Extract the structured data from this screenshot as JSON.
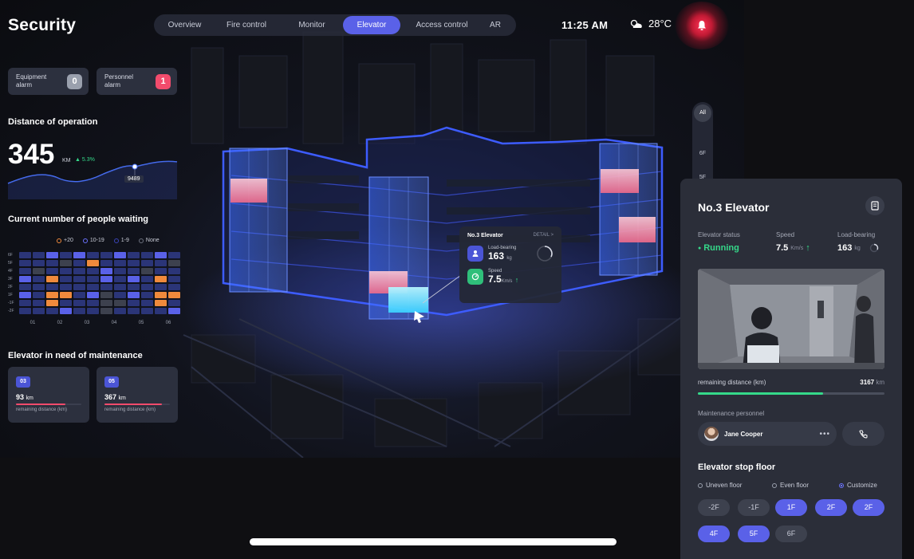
{
  "app_title": "Security",
  "nav": {
    "tabs": [
      {
        "label": "Overview",
        "active": false
      },
      {
        "label": "Fire control",
        "active": false
      },
      {
        "label": "Monitor",
        "active": false
      },
      {
        "label": "Elevator",
        "active": true
      },
      {
        "label": "Access control",
        "active": false
      },
      {
        "label": "AR",
        "active": false
      }
    ]
  },
  "header": {
    "time": "11:25 AM",
    "temperature": "28°C",
    "weather_icon": "cloud-sun-icon"
  },
  "alarms": {
    "equipment": {
      "label": "Equipment alarm",
      "count": "0"
    },
    "personnel": {
      "label": "Personnel alarm",
      "count": "1"
    }
  },
  "distance": {
    "title": "Distance of operation",
    "value": "345",
    "unit": "KM",
    "delta": "5.3%",
    "tooltip": "9489"
  },
  "waiting": {
    "title": "Current number of people waiting",
    "legend": [
      "+20",
      "10-19",
      "1-9",
      "None"
    ],
    "rows": [
      "6F",
      "5F",
      "4F",
      "3F",
      "2F",
      "1F",
      "-1F",
      "-2F"
    ],
    "cols": [
      "01",
      "02",
      "03",
      "04",
      "05",
      "06"
    ]
  },
  "maintenance": {
    "title": "Elevator in need of maintenance",
    "items": [
      {
        "id": "03",
        "value": "93",
        "unit": "km",
        "sub": "remaining distance (km)"
      },
      {
        "id": "05",
        "value": "367",
        "unit": "km",
        "sub": "remaining distance (km)"
      }
    ]
  },
  "floor_filter": [
    "All",
    "6F",
    "5F"
  ],
  "tooltip": {
    "title": "No.3 Elevator",
    "detail": "DETAIL >",
    "load_label": "Load-bearing",
    "load_value": "163",
    "load_unit": "kg",
    "speed_label": "Speed",
    "speed_value": "7.5",
    "speed_unit": "Km/s"
  },
  "panel": {
    "title": "No.3 Elevator",
    "status_label": "Elevator status",
    "status_value": "Running",
    "speed_label": "Speed",
    "speed_value": "7.5",
    "speed_unit": "Km/s",
    "load_label": "Load-bearing",
    "load_value": "163",
    "load_unit": "kg",
    "remaining_label": "remaining distance (km)",
    "remaining_value": "3167",
    "remaining_unit": "km",
    "remaining_fraction": 0.67,
    "personnel_label": "Maintenance personnel",
    "person_name": "Jane Cooper",
    "more": "•••",
    "stop_title": "Elevator stop floor",
    "radio": [
      {
        "label": "Uneven floor",
        "on": false
      },
      {
        "label": "Even floor",
        "on": false
      },
      {
        "label": "Customize",
        "on": true
      }
    ],
    "floors": [
      {
        "label": "-2F",
        "selected": false
      },
      {
        "label": "-1F",
        "selected": false
      },
      {
        "label": "1F",
        "selected": true
      },
      {
        "label": "2F",
        "selected": true
      },
      {
        "label": "2F",
        "selected": true
      },
      {
        "label": "4F",
        "selected": true
      },
      {
        "label": "5F",
        "selected": true
      },
      {
        "label": "6F",
        "selected": false
      }
    ]
  },
  "colors": {
    "accent": "#5a61e8",
    "alarm": "#f24b6c",
    "ok": "#35d98a",
    "orange": "#f08a3c"
  }
}
